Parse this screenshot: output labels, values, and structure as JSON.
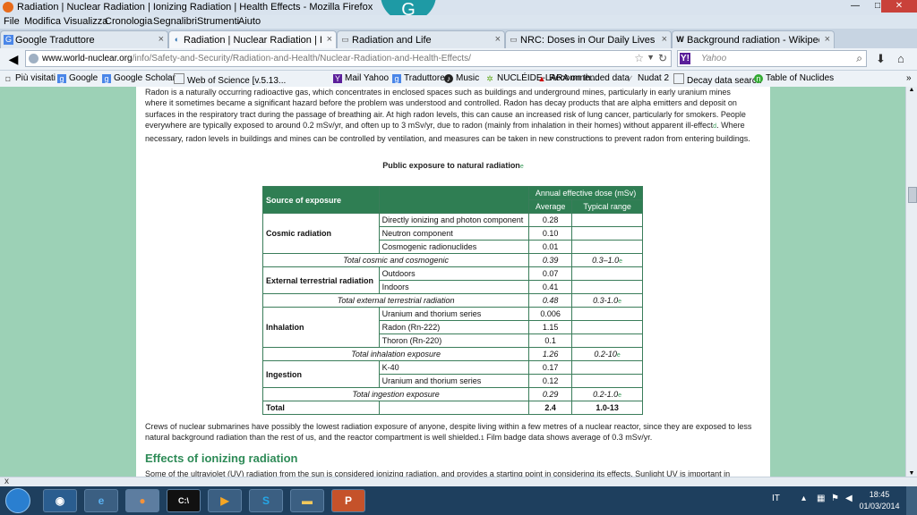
{
  "window": {
    "title": "Radiation | Nuclear Radiation | Ionizing Radiation | Health Effects - Mozilla Firefox",
    "minimize": "—",
    "maximize": "□",
    "close": "✕",
    "profile_badge": "G"
  },
  "menu": [
    "File",
    "Modifica",
    "Visualizza",
    "Cronologia",
    "Segnalibri",
    "Strumenti",
    "Aiuto"
  ],
  "tabs": [
    {
      "label": "Google Traduttore",
      "icon": "google-translate-icon"
    },
    {
      "label": "Radiation | Nuclear Radiation | Ionizin...",
      "icon": "world-nuclear-icon",
      "active": true
    },
    {
      "label": "Radiation and Life",
      "icon": "page-icon"
    },
    {
      "label": "NRC: Doses in Our Daily Lives",
      "icon": "nrc-icon"
    },
    {
      "label": "Background radiation - Wikipedia, th...",
      "icon": "wikipedia-icon"
    }
  ],
  "tab_close": "×",
  "new_tab": "+",
  "address": {
    "domain": "www.world-nuclear.org",
    "path": "/info/Safety-and-Security/Radiation-and-Health/Nuclear-Radiation-and-Health-Effects/"
  },
  "search": {
    "engine_glyph": "Y!",
    "placeholder": "Yahoo"
  },
  "bookmarks": [
    "Più visitati",
    "Google",
    "Google Scholar",
    "Web of Science [v.5.13...",
    "Mail Yahoo",
    "Traduttore",
    "Music",
    "NUCLÉIDE-LARA on th...",
    "Recommended data",
    "Nudat 2",
    "Decay data search",
    "Table of Nuclides"
  ],
  "bookmarks_overflow": "»",
  "article": {
    "intro": "Radon is a naturally occurring radioactive gas, which concentrates in enclosed spaces such as buildings and underground mines, particularly in early uranium mines where it sometimes became a significant hazard before the problem was understood and controlled. Radon has decay products that are alpha emitters and deposit on surfaces in the respiratory tract during the passage of breathing air. At high radon levels, this can cause an increased risk of lung cancer, particularly for smokers. People everywhere are typically exposed to around 0.2 mSv/yr, and often up to 3 mSv/yr, due to radon (mainly from inhalation in their homes) without apparent ill-effect",
    "intro_ref": "d",
    "intro_end": ". Where necessary, radon levels in buildings and mines can be controlled by ventilation, and measures can be taken in new constructions to prevent radon from entering buildings.",
    "table_title": "Public exposure to natural radiation",
    "table_title_ref": "e",
    "table": {
      "h_source": "Source of exposure",
      "h_dose": "Annual effective dose (mSv)",
      "h_avg": "Average",
      "h_range": "Typical range",
      "groups": [
        {
          "name": "Cosmic radiation",
          "rows": [
            {
              "label": "Directly ionizing and photon component",
              "avg": "0.28"
            },
            {
              "label": "Neutron component",
              "avg": "0.10"
            },
            {
              "label": "Cosmogenic radionuclides",
              "avg": "0.01"
            }
          ],
          "total": {
            "label": "Total cosmic and cosmogenic",
            "avg": "0.39",
            "range": "0.3–1.0",
            "ref": "e"
          }
        },
        {
          "name": "External terrestrial radiation",
          "rows": [
            {
              "label": "Outdoors",
              "avg": "0.07"
            },
            {
              "label": "Indoors",
              "avg": "0.41"
            }
          ],
          "total": {
            "label": "Total external terrestrial radiation",
            "avg": "0.48",
            "range": "0.3-1.0",
            "ref": "e"
          }
        },
        {
          "name": "Inhalation",
          "rows": [
            {
              "label": "Uranium and thorium series",
              "avg": "0.006"
            },
            {
              "label": "Radon (Rn-222)",
              "avg": "1.15"
            },
            {
              "label": "Thoron (Rn-220)",
              "avg": "0.1"
            }
          ],
          "total": {
            "label": "Total inhalation exposure",
            "avg": "1.26",
            "range": "0.2-10",
            "ref": "e"
          }
        },
        {
          "name": "Ingestion",
          "rows": [
            {
              "label": "K-40",
              "avg": "0.17"
            },
            {
              "label": "Uranium and thorium series",
              "avg": "0.12"
            }
          ],
          "total": {
            "label": "Total ingestion exposure",
            "avg": "0.29",
            "range": "0.2-1.0",
            "ref": "e"
          }
        }
      ],
      "grand_total": {
        "label": "Total",
        "avg": "2.4",
        "range": "1.0-13"
      }
    },
    "after": "Crews of nuclear submarines have possibly the lowest radiation exposure of anyone, despite living within a few metres of a nuclear reactor, since they are exposed to less natural background radiation than the rest of us, and the reactor compartment is well shielded.",
    "after_ref": "1",
    "after_end": " Film badge data shows average of 0.3 mSv/yr.",
    "heading": "Effects of ionizing radiation",
    "cutoff": "Some of the ultraviolet (UV) radiation from the sun is considered ionizing radiation, and provides a starting point in considering its effects. Sunlight UV is important in"
  },
  "findbar_close": "x",
  "taskbar": {
    "apps": [
      "outlook-icon",
      "internet-explorer-icon",
      "firefox-icon",
      "terminal-icon",
      "media-player-icon",
      "skype-icon",
      "file-explorer-icon",
      "powerpoint-icon"
    ],
    "language": "IT",
    "time": "18:45",
    "date": "01/03/2014"
  },
  "colors": {
    "page_bg": "#9cd1b6",
    "table_header": "#2f7e53",
    "heading": "#2e8b57",
    "taskbar": "#1e3f5e"
  }
}
